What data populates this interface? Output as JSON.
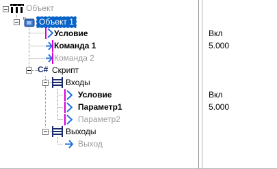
{
  "tree": {
    "root": {
      "label": "Объект"
    },
    "object": {
      "label": "Объект 1",
      "children": [
        {
          "label": "Условие",
          "value": "Вкл"
        },
        {
          "label": "Команда 1",
          "value": "5.000"
        },
        {
          "label": "Команда 2",
          "value": ""
        }
      ]
    },
    "script": {
      "icon_text": "C#",
      "label": "Скрипт",
      "inputs": {
        "label": "Входы",
        "children": [
          {
            "label": "Условие",
            "value": "Вкл"
          },
          {
            "label": "Параметр1",
            "value": "5.000"
          },
          {
            "label": "Параметр2",
            "value": ""
          }
        ]
      },
      "outputs": {
        "label": "Выходы",
        "children": [
          {
            "label": "Выход",
            "value": ""
          }
        ]
      }
    }
  },
  "colors": {
    "selection": "#0a64c8",
    "arrow_blue": "#1d6fe0",
    "arrow_bar_magenta": "#d400d4",
    "disabled_text": "#9b9b9b"
  }
}
